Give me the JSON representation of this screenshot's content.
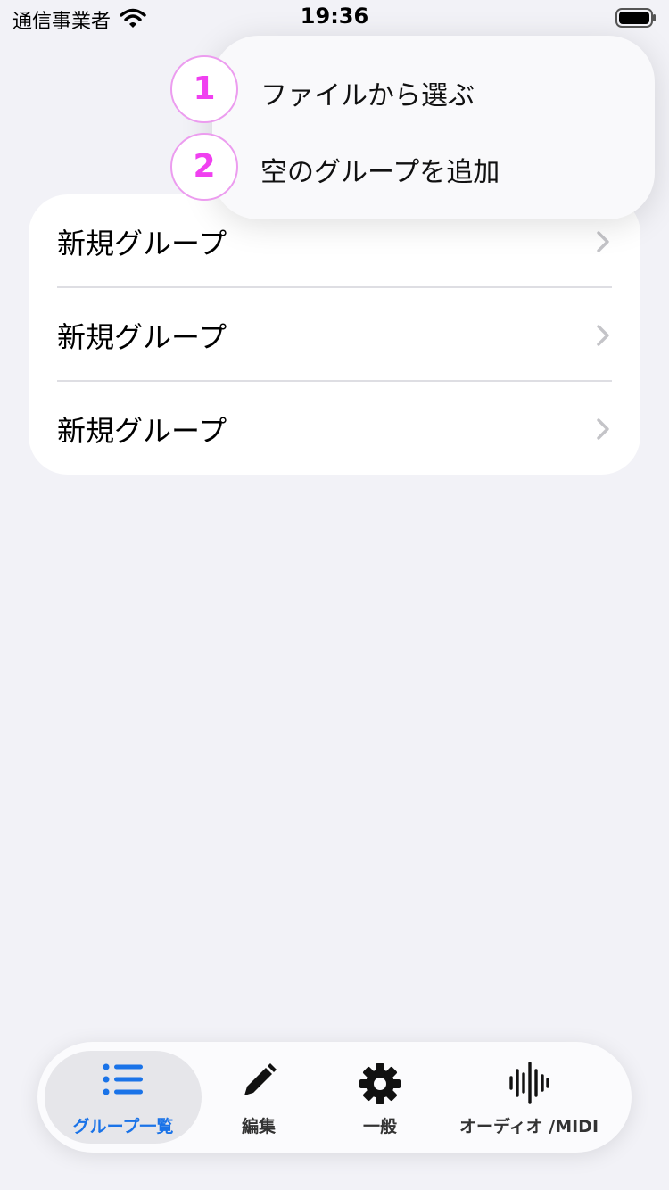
{
  "status_bar": {
    "carrier": "通信事業者",
    "time": "19:36",
    "wifi_icon": "wifi-icon",
    "battery_icon": "battery-icon"
  },
  "group_list": {
    "rows": [
      {
        "label": "新規グループ"
      },
      {
        "label": "新規グループ"
      },
      {
        "label": "新規グループ"
      }
    ]
  },
  "add_menu": {
    "items": [
      {
        "badge": "1",
        "label": "ファイルから選ぶ"
      },
      {
        "badge": "2",
        "label": "空のグループを追加"
      }
    ]
  },
  "tab_bar": {
    "active_color": "#1a73e8",
    "tabs": [
      {
        "label": "グループ一覧",
        "icon": "list-icon",
        "active": true
      },
      {
        "label": "編集",
        "icon": "pencil-icon",
        "active": false
      },
      {
        "label": "一般",
        "icon": "gear-icon",
        "active": false
      },
      {
        "label": "オーディオ /MIDI",
        "icon": "waveform-icon",
        "active": false
      }
    ]
  }
}
